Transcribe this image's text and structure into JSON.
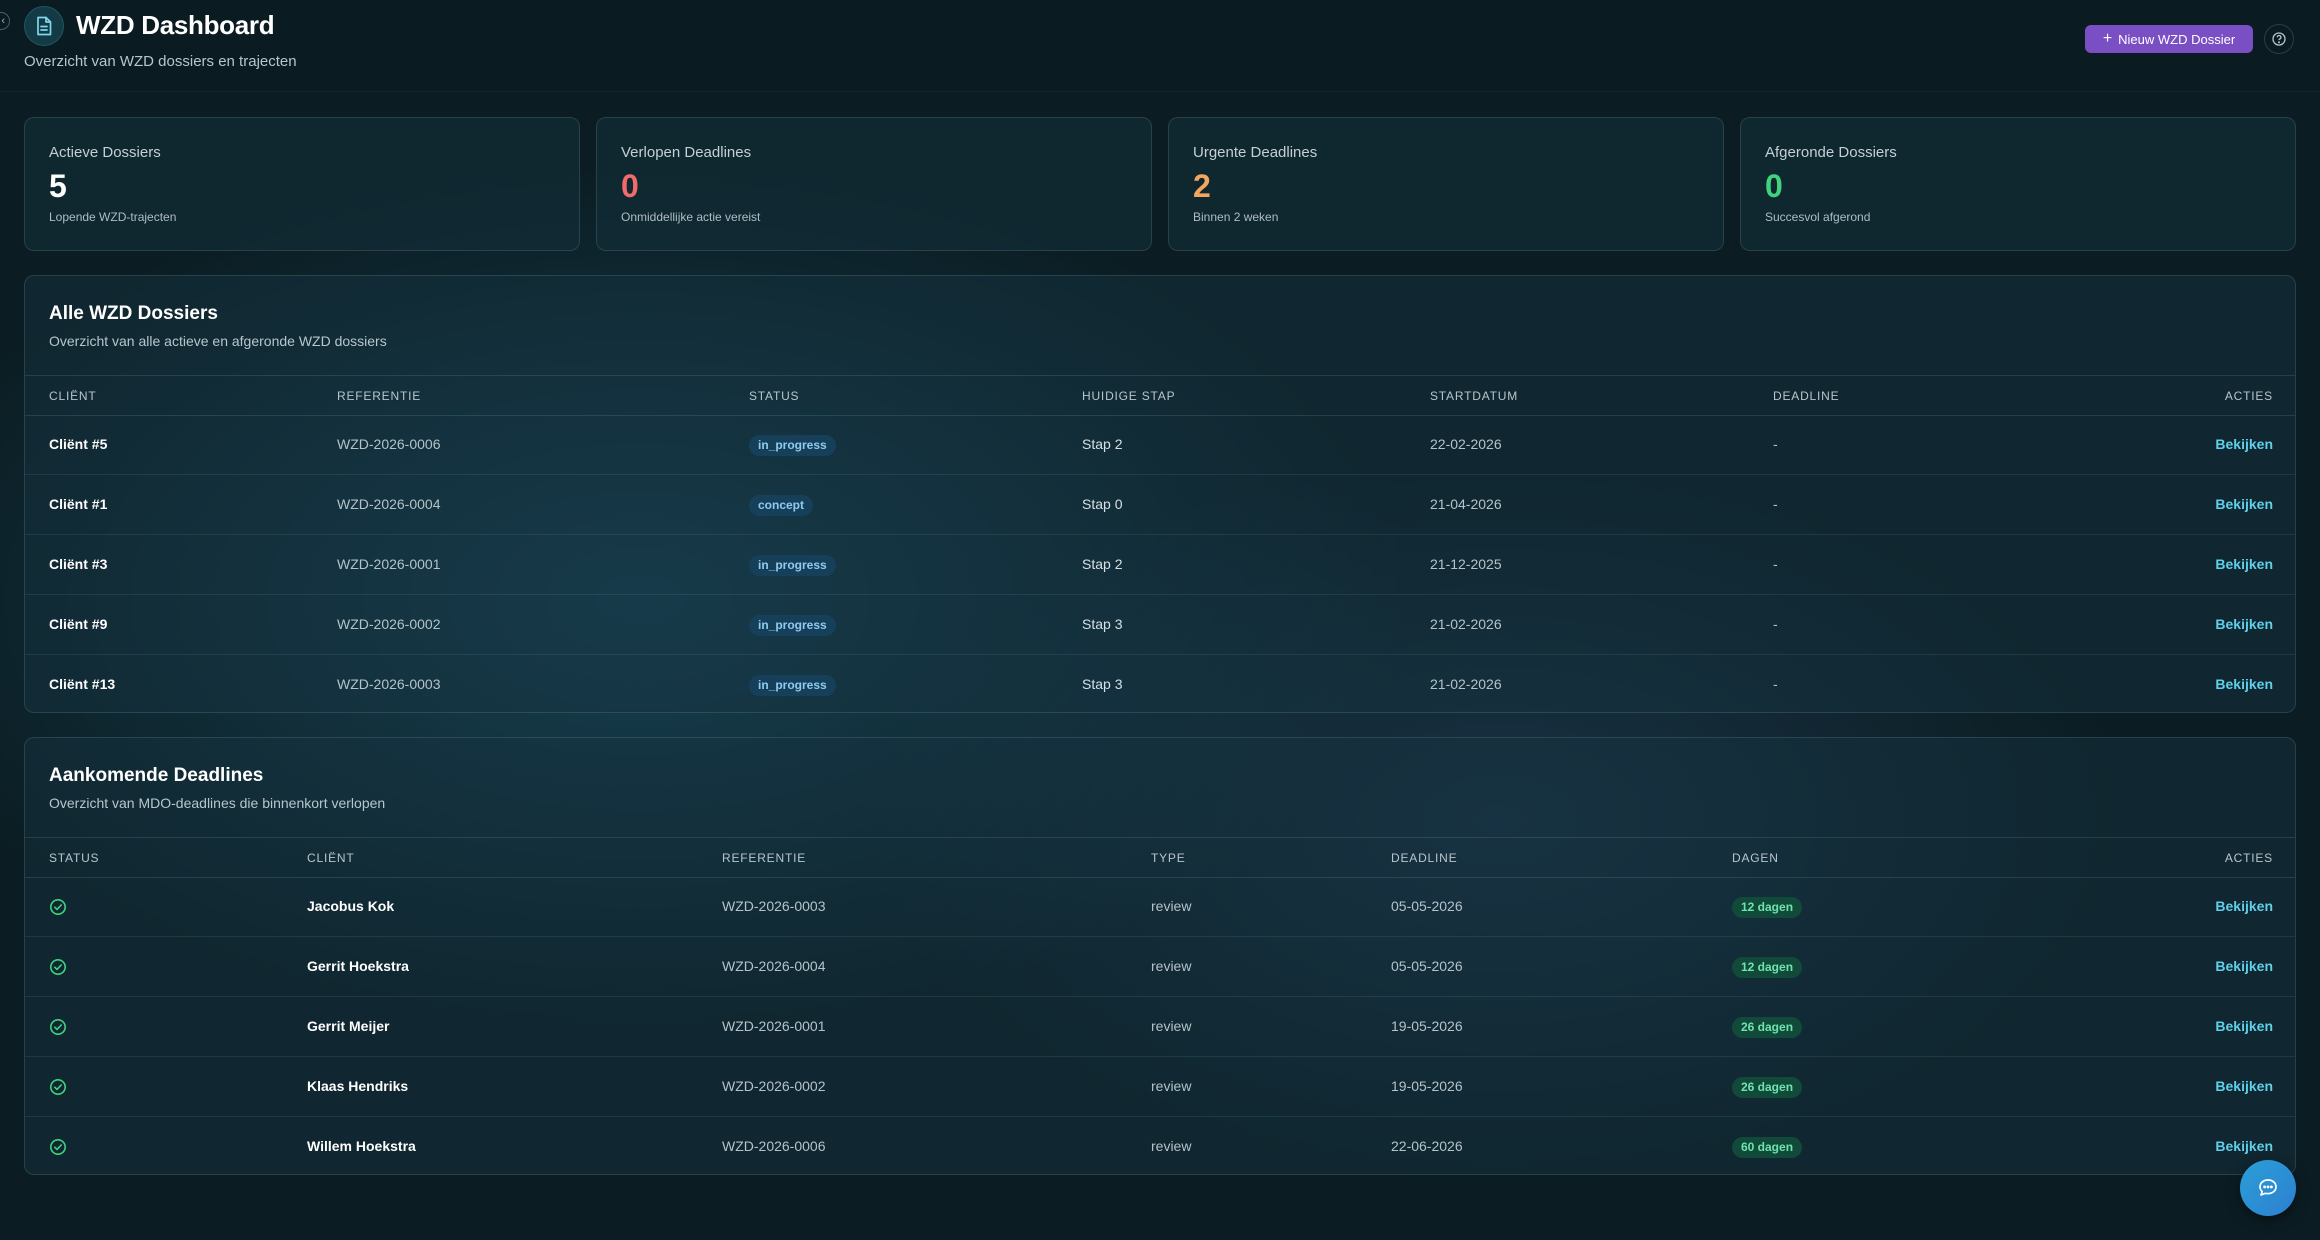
{
  "header": {
    "title": "WZD Dashboard",
    "subtitle": "Overzicht van WZD dossiers en trajecten",
    "new_button_label": "Nieuw WZD Dossier"
  },
  "stats": [
    {
      "label": "Actieve Dossiers",
      "value": "5",
      "desc": "Lopende WZD-trajecten",
      "color": "#ffffff"
    },
    {
      "label": "Verlopen Deadlines",
      "value": "0",
      "desc": "Onmiddellijke actie vereist",
      "color": "#f06b6b"
    },
    {
      "label": "Urgente Deadlines",
      "value": "2",
      "desc": "Binnen 2 weken",
      "color": "#f2a660"
    },
    {
      "label": "Afgeronde Dossiers",
      "value": "0",
      "desc": "Succesvol afgerond",
      "color": "#3fd37f"
    }
  ],
  "dossiers": {
    "title": "Alle WZD Dossiers",
    "subtitle": "Overzicht van alle actieve en afgeronde WZD dossiers",
    "columns": [
      "Cliënt",
      "Referentie",
      "Status",
      "Huidige Stap",
      "Startdatum",
      "Deadline",
      "Acties"
    ],
    "rows": [
      {
        "client": "Cliënt #5",
        "ref": "WZD-2026-0006",
        "status": "in_progress",
        "step": "Stap 2",
        "start": "22-02-2026",
        "deadline": "-",
        "action": "Bekijken"
      },
      {
        "client": "Cliënt #1",
        "ref": "WZD-2026-0004",
        "status": "concept",
        "step": "Stap 0",
        "start": "21-04-2026",
        "deadline": "-",
        "action": "Bekijken"
      },
      {
        "client": "Cliënt #3",
        "ref": "WZD-2026-0001",
        "status": "in_progress",
        "step": "Stap 2",
        "start": "21-12-2025",
        "deadline": "-",
        "action": "Bekijken"
      },
      {
        "client": "Cliënt #9",
        "ref": "WZD-2026-0002",
        "status": "in_progress",
        "step": "Stap 3",
        "start": "21-02-2026",
        "deadline": "-",
        "action": "Bekijken"
      },
      {
        "client": "Cliënt #13",
        "ref": "WZD-2026-0003",
        "status": "in_progress",
        "step": "Stap 3",
        "start": "21-02-2026",
        "deadline": "-",
        "action": "Bekijken"
      }
    ]
  },
  "deadlines": {
    "title": "Aankomende Deadlines",
    "subtitle": "Overzicht van MDO-deadlines die binnenkort verlopen",
    "columns": [
      "Status",
      "Cliënt",
      "Referentie",
      "Type",
      "Deadline",
      "Dagen",
      "Acties"
    ],
    "rows": [
      {
        "client": "Jacobus Kok",
        "ref": "WZD-2026-0003",
        "type": "review",
        "deadline": "05-05-2026",
        "days": "12 dagen",
        "action": "Bekijken"
      },
      {
        "client": "Gerrit Hoekstra",
        "ref": "WZD-2026-0004",
        "type": "review",
        "deadline": "05-05-2026",
        "days": "12 dagen",
        "action": "Bekijken"
      },
      {
        "client": "Gerrit Meijer",
        "ref": "WZD-2026-0001",
        "type": "review",
        "deadline": "19-05-2026",
        "days": "26 dagen",
        "action": "Bekijken"
      },
      {
        "client": "Klaas Hendriks",
        "ref": "WZD-2026-0002",
        "type": "review",
        "deadline": "19-05-2026",
        "days": "26 dagen",
        "action": "Bekijken"
      },
      {
        "client": "Willem Hoekstra",
        "ref": "WZD-2026-0006",
        "type": "review",
        "deadline": "22-06-2026",
        "days": "60 dagen",
        "action": "Bekijken"
      }
    ]
  },
  "icons": {
    "app": "document-icon",
    "new": "plus-icon",
    "help": "help-circle-icon",
    "status_ok": "check-circle-icon",
    "chat": "chat-bubble-icon",
    "collapse": "chevron-left-icon"
  },
  "colors": {
    "accent": "#7a4fc4",
    "link": "#5fd0ea",
    "status_badge": "#8fcbf0",
    "days_badge": "#6ee3b0",
    "ok": "#3fd37f"
  }
}
